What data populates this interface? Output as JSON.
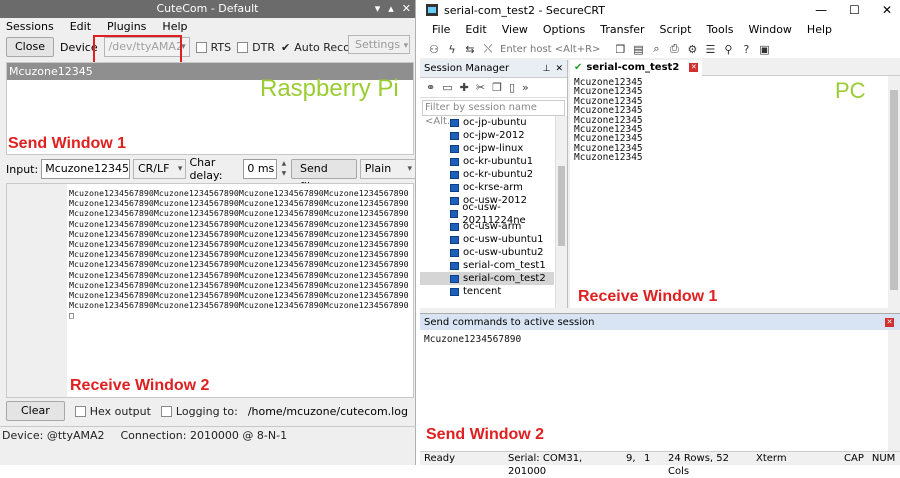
{
  "cutecom": {
    "title": "CuteCom - Default",
    "menu": [
      "Sessions",
      "Edit",
      "Plugins",
      "Help"
    ],
    "toolbar": {
      "close_label": "Close",
      "device_label": "Device",
      "device_value": "/dev/ttyAMA2",
      "rts_label": "RTS",
      "dtr_label": "DTR",
      "auto_reconnect_label": "Auto Reconnect",
      "settings_label": "Settings"
    },
    "send_header": "Mcuzone12345",
    "overlay_send_window": "Send Window 1",
    "overlay_platform": "Raspberry Pi",
    "input": {
      "label": "Input:",
      "value": "Mcuzone12345",
      "line_ending": "CR/LF",
      "char_delay_label": "Char delay:",
      "char_delay_value": "0 ms",
      "send_file_label": "Send file...",
      "mode": "Plain"
    },
    "receive_text": "Mcuzone1234567890Mcuzone1234567890Mcuzone1234567890Mcuzone1234567890Mcuzone1234567890Mcuzone1234567890Mcuzone1234567890Mcuzone1234567890Mcuzone1234567890Mcuzone1234567890Mcuzone1234567890Mcuzone1234567890Mcuzone1234567890Mcuzone1234567890Mcuzone1234567890Mcuzone1234567890Mcuzone1234567890Mcuzone1234567890Mcuzone1234567890Mcuzone1234567890Mcuzone1234567890Mcuzone1234567890Mcuzone1234567890Mcuzone1234567890Mcuzone1234567890Mcuzone1234567890Mcuzone1234567890Mcuzone1234567890Mcuzone1234567890Mcuzone1234567890Mcuzone1234567890Mcuzone1234567890Mcuzone1234567890Mcuzone1234567890Mcuzone1234567890Mcuzone1234567890Mcuzone1234567890Mcuzone1234567890Mcuzone1234567890Mcuzone1234567890Mcuzone1234567890Mcuzone1234567890Mcuzone1234567890Mcuzone1234567890Mcuzone1234567890Mcuzone1234567890Mcuzone1234567890Mcuzone1234567890□",
    "overlay_receive_window": "Receive Window 2",
    "bottom": {
      "clear_label": "Clear",
      "hex_output_label": "Hex output",
      "logging_label": "Logging to:",
      "log_path": "/home/mcuzone/cutecom.log"
    },
    "status": {
      "device": "Device:   @ttyAMA2",
      "connection": "Connection: 2010000 @ 8-N-1"
    }
  },
  "securecrt": {
    "title": "serial-com_test2 - SecureCRT",
    "menu": [
      "File",
      "Edit",
      "View",
      "Options",
      "Transfer",
      "Script",
      "Tools",
      "Window",
      "Help"
    ],
    "host_placeholder": "Enter host <Alt+R>",
    "session_manager": {
      "title": "Session Manager",
      "filter_placeholder": "Filter by session name <Alt...",
      "sessions": [
        "oc-jp-ubuntu",
        "oc-jpw-2012",
        "oc-jpw-linux",
        "oc-kr-ubuntu1",
        "oc-kr-ubuntu2",
        "oc-krse-arm",
        "oc-usw-2012",
        "oc-usw-20211224ne",
        "oc-usw-arm",
        "oc-usw-ubuntu1",
        "oc-usw-ubuntu2",
        "serial-com_test1",
        "serial-com_test2",
        "tencent"
      ],
      "selected": "serial-com_test2"
    },
    "terminal": {
      "tab_label": "serial-com_test2",
      "lines": [
        "Mcuzone12345",
        "Mcuzone12345",
        "Mcuzone12345",
        "Mcuzone12345",
        "Mcuzone12345",
        "Mcuzone12345",
        "Mcuzone12345",
        "Mcuzone12345",
        "Mcuzone12345"
      ],
      "overlay_platform": "PC",
      "overlay_receive_window": "Receive Window 1"
    },
    "command_window": {
      "title": "Send commands to active session",
      "text": "Mcuzone1234567890",
      "overlay_send_window": "Send Window 2"
    },
    "status": {
      "ready": "Ready",
      "serial": "Serial: COM31, 201000",
      "row": "9,",
      "col": "1",
      "size": "24 Rows, 52 Cols",
      "term": "Xterm",
      "cap": "CAP",
      "num": "NUM"
    }
  },
  "colors": {
    "overlay_red": "#e02020",
    "overlay_green": "#9acd32",
    "cutecom_titlebar": "#6b6b6b",
    "session_monitor_icon": "#1d5fb9"
  }
}
